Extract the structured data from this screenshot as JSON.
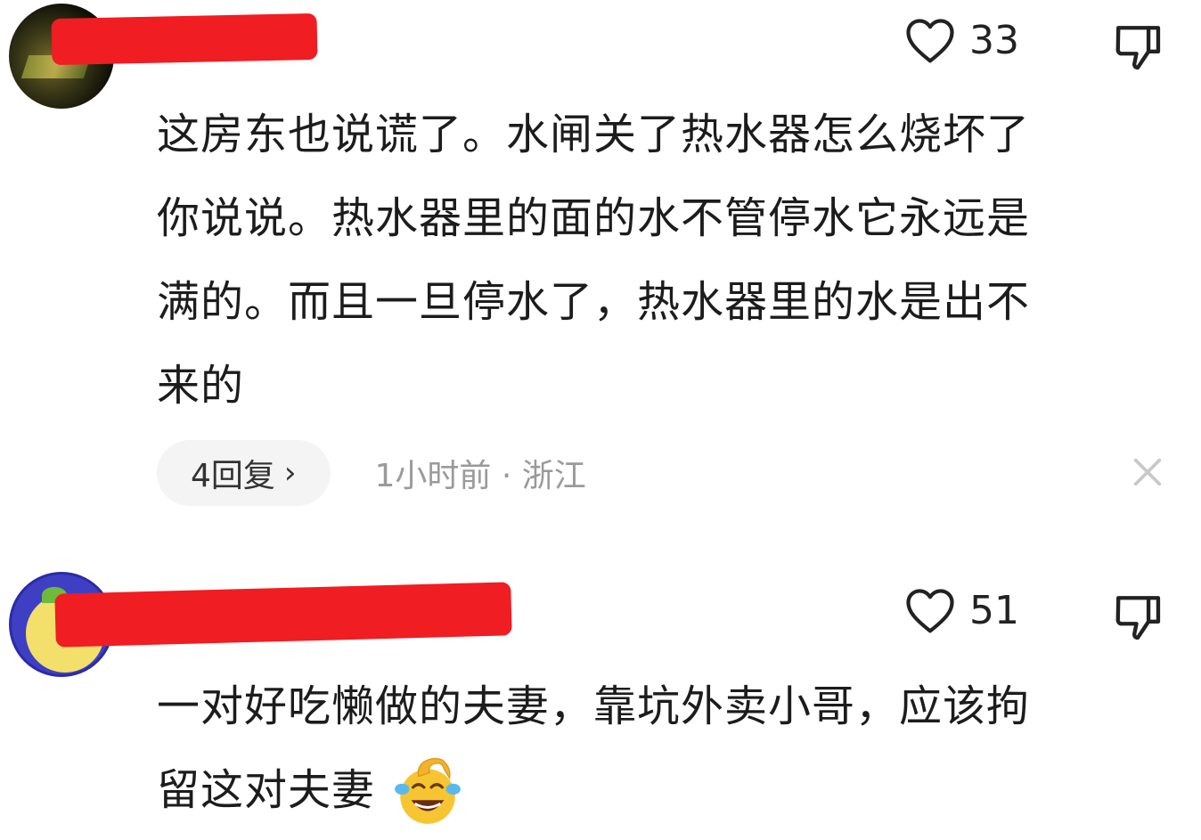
{
  "comments": [
    {
      "likes": "33",
      "text_lines": [
        "这房东也说谎了。水闸关了热水器怎么烧坏了",
        "你说说。热水器里的面的水不管停水它永远是",
        "满的。而且一旦停水了，热水器里的水是出不",
        "来的"
      ],
      "replies_label": "4回复",
      "time": "1小时前",
      "separator": "·",
      "location": "浙江"
    },
    {
      "likes": "51",
      "text_lines": [
        "一对好吃懒做的夫妻，靠坑外卖小哥，应该拘",
        "留这对夫妻"
      ],
      "emoji": "laughing-crying-emoji"
    }
  ],
  "icons": {
    "like": "heart-outline-icon",
    "dislike": "thumbs-down-icon",
    "close": "close-icon",
    "reply_chevron": "chevron-right-icon"
  },
  "colors": {
    "redaction": "#f01d22",
    "text": "#1c1c1c",
    "muted": "#9a9a9a",
    "pill_bg": "#f4f4f4"
  }
}
